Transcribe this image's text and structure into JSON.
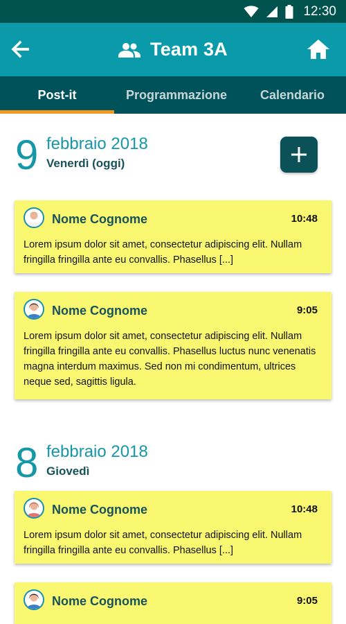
{
  "status_bar": {
    "time": "12:30"
  },
  "app_bar": {
    "title": "Team 3A"
  },
  "tabs": [
    {
      "label": "Post-it",
      "active": true
    },
    {
      "label": "Programmazione",
      "active": false
    },
    {
      "label": "Calendario",
      "active": false
    }
  ],
  "days": [
    {
      "day_number": "9",
      "month_year": "febbraio 2018",
      "weekday": "Venerdì (oggi)",
      "notes": [
        {
          "author": "Nome Cognome",
          "time": "10:48",
          "text": "Lorem ipsum dolor sit amet, consectetur adipiscing elit. Nullam fringilla fringilla ante eu convallis. Phasellus [...]"
        },
        {
          "author": "Nome Cognome",
          "time": "9:05",
          "text": "Lorem ipsum dolor sit amet, consectetur adipiscing elit. Nullam fringilla fringilla ante eu convallis. Phasellus luctus nunc venenatis magna interdum maximus. Sed non mi condimentum, ultrices neque sed, sagittis ligula."
        }
      ]
    },
    {
      "day_number": "8",
      "month_year": "febbraio 2018",
      "weekday": "Giovedì",
      "notes": [
        {
          "author": "Nome Cognome",
          "time": "10:48",
          "text": "Lorem ipsum dolor sit amet, consectetur adipiscing elit. Nullam fringilla fringilla ante eu convallis. Phasellus [...]"
        },
        {
          "author": "Nome Cognome",
          "time": "9:05",
          "text": ""
        }
      ]
    }
  ],
  "icons": {
    "back": "arrow-back-icon",
    "group": "group-icon",
    "home": "home-icon",
    "add": "plus-icon",
    "wifi": "wifi-icon",
    "signal": "signal-icon",
    "battery": "battery-icon"
  },
  "colors": {
    "status_bar": "#00524f",
    "app_bar": "#0a9aaa",
    "tab_bar": "#00525a",
    "tab_indicator": "#f39a1e",
    "accent": "#1597a7",
    "note_background": "#faf870",
    "add_button": "#0a5257"
  }
}
